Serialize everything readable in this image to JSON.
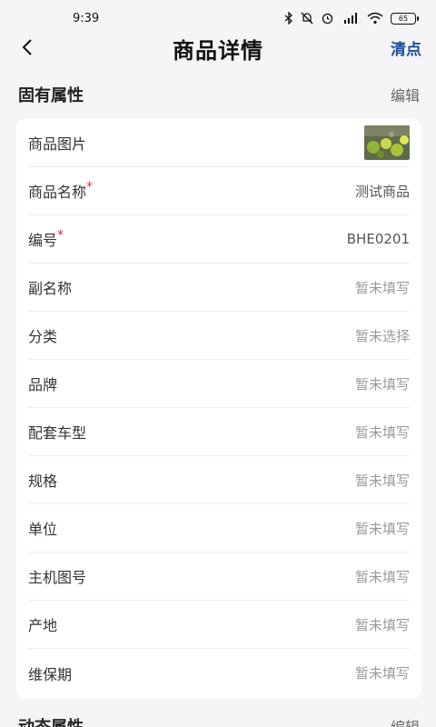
{
  "status": {
    "time": "9:39",
    "battery": "65"
  },
  "nav": {
    "title": "商品详情",
    "action": "清点"
  },
  "section_fixed": {
    "title": "固有属性",
    "edit": "编辑"
  },
  "rows": [
    {
      "label": "商品图片",
      "required": false,
      "value": "",
      "type": "image"
    },
    {
      "label": "商品名称",
      "required": true,
      "value": "测试商品"
    },
    {
      "label": "编号",
      "required": true,
      "value": "BHE0201"
    },
    {
      "label": "副名称",
      "required": false,
      "value": "暂未填写",
      "empty": true
    },
    {
      "label": "分类",
      "required": false,
      "value": "暂未选择",
      "empty": true
    },
    {
      "label": "品牌",
      "required": false,
      "value": "暂未填写",
      "empty": true
    },
    {
      "label": "配套车型",
      "required": false,
      "value": "暂未填写",
      "empty": true
    },
    {
      "label": "规格",
      "required": false,
      "value": "暂未填写",
      "empty": true
    },
    {
      "label": "单位",
      "required": false,
      "value": "暂未填写",
      "empty": true
    },
    {
      "label": "主机图号",
      "required": false,
      "value": "暂未填写",
      "empty": true
    },
    {
      "label": "产地",
      "required": false,
      "value": "暂未填写",
      "empty": true
    },
    {
      "label": "维保期",
      "required": false,
      "value": "暂未填写",
      "empty": true
    }
  ],
  "required_mark": "*",
  "section_dynamic": {
    "title": "动态属性",
    "edit": "编辑"
  },
  "colors": {
    "accent": "#1a4fa0",
    "required": "#e02b2b",
    "background": "#f5f5f7"
  }
}
